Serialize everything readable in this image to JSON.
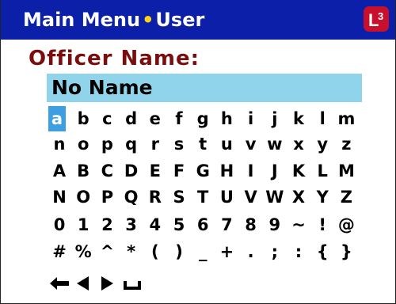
{
  "titlebar": {
    "crumb_main": "Main Menu",
    "separator": "•",
    "crumb_sub": "User",
    "logo_text": "L3"
  },
  "form": {
    "label": "Officer Name:",
    "value": "No Name"
  },
  "keyboard": {
    "selected_key": "a",
    "rows": [
      [
        "a",
        "b",
        "c",
        "d",
        "e",
        "f",
        "g",
        "h",
        "i",
        "j",
        "k",
        "l",
        "m"
      ],
      [
        "n",
        "o",
        "p",
        "q",
        "r",
        "s",
        "t",
        "u",
        "v",
        "w",
        "x",
        "y",
        "z"
      ],
      [
        "A",
        "B",
        "C",
        "D",
        "E",
        "F",
        "G",
        "H",
        "I",
        "J",
        "K",
        "L",
        "M"
      ],
      [
        "N",
        "O",
        "P",
        "Q",
        "R",
        "S",
        "T",
        "U",
        "V",
        "W",
        "X",
        "Y",
        "Z"
      ],
      [
        "0",
        "1",
        "2",
        "3",
        "4",
        "5",
        "6",
        "7",
        "8",
        "9",
        "~",
        "!",
        "@"
      ],
      [
        "#",
        "%",
        "^",
        "*",
        "(",
        ")",
        "_",
        "+",
        ".",
        ";",
        ":",
        "{",
        "}"
      ]
    ],
    "controls": [
      "backspace-arrow-icon",
      "cursor-left-icon",
      "cursor-right-icon",
      "space-icon"
    ]
  },
  "colors": {
    "titlebar": "#0b1fa8",
    "separator": "#ffd21a",
    "label": "#7a0d0d",
    "field": "#8fd4ea",
    "selection": "#3e9fe0",
    "logo": "#c8102e"
  }
}
